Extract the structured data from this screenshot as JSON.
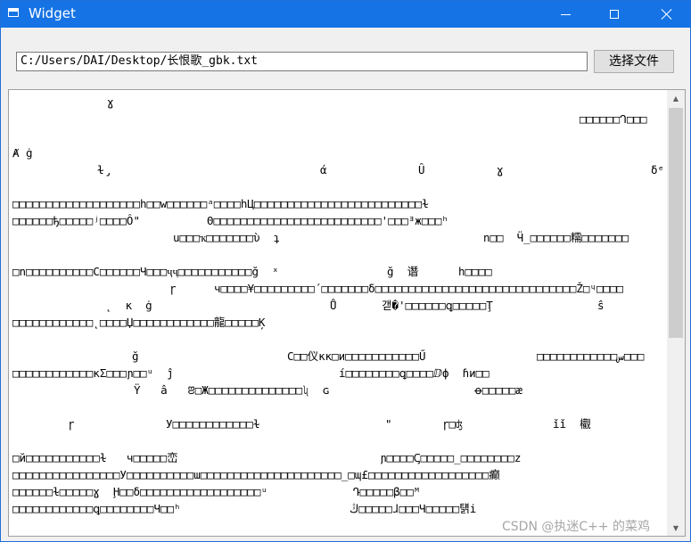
{
  "window": {
    "title": "Widget",
    "colors": {
      "titlebar": "#1573e5",
      "background": "#f0f0f0",
      "textarea_bg": "#ffffff"
    }
  },
  "file_bar": {
    "path_value": "C:/Users/DAI/Desktop/长恨歌_gbk.txt",
    "choose_button_label": "选择文件"
  },
  "text_area": {
    "lines": [
      {
        "segs": [
          "ɣ"
        ]
      },
      {
        "segs": [
          "□□□□□□ᒉ□□□"
        ]
      },
      {
        "segs": []
      },
      {
        "segs": [
          "Ⱥ ġ"
        ]
      },
      {
        "segs": [
          "ɫ̡",
          "ά",
          "Ȗ",
          "ɣ",
          "δᵉ"
        ]
      },
      {
        "segs": []
      },
      {
        "segs": [
          "□□□□□□□□□□□□□□□□□□□h□□w□□□□□□ᵃ□□□□hЦ□□□□□□□□□□□□□□□□□□□□□□□□□ɫ"
        ]
      },
      {
        "segs": [
          "□□□□□□ђ□□□□□ʲ□□□□Ô\"",
          "Θ□□□□□□□□□□□□□□□□□□□□□□□□□'□□□ᴲж□□□ʰ"
        ]
      },
      {
        "segs": [
          "u□□□ҡ□□□□□□□ὺ  ʇ",
          "n□□  Ӵ_□□□□□□糯□□□□□□□"
        ]
      },
      {
        "segs": []
      },
      {
        "segs": [
          "□n□□□□□□□□□□C□□□□□□Ч□□□ҷҷ□□□□□□□□□□□ğ  ˣ",
          "ğ  谮",
          "h□□□□"
        ]
      },
      {
        "segs": [
          "ɼ",
          "ч□□□□¥□□□□□□□□□´□□□□□□□δ□□□□□□□□□□□□□□□□□□□□□□□□□□□□□□Ž□ᶣ□□□□"
        ]
      },
      {
        "segs": [
          "˛  κ  ġ",
          "Ů",
          "갣�'□□□□□□ꝗ□□□□□Ţ",
          "ŝ"
        ]
      },
      {
        "segs": [
          "□□□□□□□□□□□□˛□□□□Џ□□□□□□□□□□□□龍□□□□□Ķ"
        ]
      },
      {
        "segs": []
      },
      {
        "segs": [
          "ğ",
          "C□□仪кк□и□□□□□□□□□□□Ű",
          "□□□□□□□□□□□□ﺱ□□□"
        ]
      },
      {
        "segs": [
          "□□□□□□□□□□□□кΣ□□□ɲ□□ᵘ  ĵ",
          "í□□□□□□□□ꝗ□□□□ⅅф  ɦи□□"
        ]
      },
      {
        "segs": [
          "Ÿ   â   ꢂ□Ж□□□□□□□□□□□□□□ʯ  ɢ",
          "ꝋ□□□□□æ"
        ]
      },
      {
        "segs": []
      },
      {
        "segs": [
          "ɼ",
          "У□□□□□□□□□□□□ɫ",
          "\"",
          "ɼ□ʤ",
          "ǐǐ  欟"
        ]
      },
      {
        "segs": []
      },
      {
        "segs": [
          "□й□□□□□□□□□□□ɫ   ч□□□□□峦",
          "ɲ□□□□Ꞔ□□□□□_□□□□□□□□z"
        ]
      },
      {
        "segs": [
          "□□□□□□□□□□□□□□□□У□□□□□□□□□□ɯ□□□□□□□□□□□□□□□□□□□□□_□ɰ£□□□□□□□□□□□□□□□□□□癫"
        ]
      },
      {
        "segs": [
          "□□□□□□ɫ□□□□□ɣ  Ḩ□□δ□□□□□□□□□□□□□□□□□□ᵘ",
          "Դ□□□□□β□□ᴹ"
        ]
      },
      {
        "segs": [
          "□□□□□□□□□□□□ꝗ□□□□□□□□Ч□□ʰ",
          "ڭ□□□□□ɺ□□□Ч□□□□□턝i"
        ]
      }
    ]
  },
  "watermark": "CSDN @执迷C++ 的菜鸡"
}
